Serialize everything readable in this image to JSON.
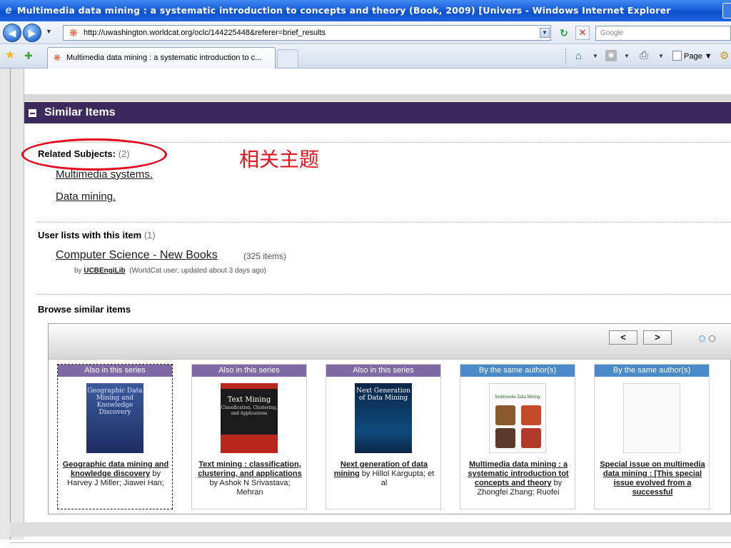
{
  "window": {
    "title": "Multimedia data mining : a systematic introduction to concepts and theory (Book, 2009) [Univers - Windows Internet Explorer"
  },
  "navbar": {
    "url": "http://uwashington.worldcat.org/oclc/144225448&referer=brief_results",
    "search_placeholder": "Google"
  },
  "tabs": {
    "active_label": "Multimedia data mining : a systematic introduction to c...",
    "page_menu": "Page"
  },
  "section": {
    "title": "Similar Items"
  },
  "related": {
    "label": "Related Subjects:",
    "count": "(2)",
    "subjects": [
      "Multimedia systems.",
      "Data mining."
    ]
  },
  "annotation": {
    "text": "相关主题"
  },
  "user_lists": {
    "label": "User lists with this item",
    "count": "(1)",
    "list_name": "Computer Science - New Books",
    "list_count": "(325 items)",
    "by": "by",
    "user": "UCBEngiLib",
    "meta": "(WorldCat user; updated about 3 days ago)"
  },
  "browse": {
    "label": "Browse similar items",
    "prev": "<",
    "next": ">"
  },
  "cards": [
    {
      "tag": "Also in this series",
      "title": "Geographic data mining and knowledge discovery",
      "by": "by Harvey J Miller; Jiawei Han;",
      "cover_text": "Geographic Data Mining and Knowledge Discovery"
    },
    {
      "tag": "Also in this series",
      "title": "Text mining : classification, clustering, and applications",
      "by": "by Ashok N Srivastava; Mehran",
      "cover_text": "Text Mining",
      "cover_sub": "Classification, Clustering, and Applications"
    },
    {
      "tag": "Also in this series",
      "title": "Next generation of data mining",
      "by": "by Hillol Kargupta; et al",
      "cover_text": "Next Generation of Data Mining"
    },
    {
      "tag": "By the same author(s)",
      "title": "Multimedia data mining : a systematic introduction tot concepts and theory",
      "by": "by Zhongfei Zhang; Ruofei",
      "cover_text": "Multimedia Data Mining"
    },
    {
      "tag": "By the same author(s)",
      "title": "Special issue on multimedia data mining : [This special issue evolved from a successful",
      "by": ""
    }
  ],
  "colors": {
    "section_header": "#3b2a5c",
    "series_tag": "#7f6aa5",
    "author_tag": "#4a8ac8",
    "annotation": "#e3001b"
  }
}
